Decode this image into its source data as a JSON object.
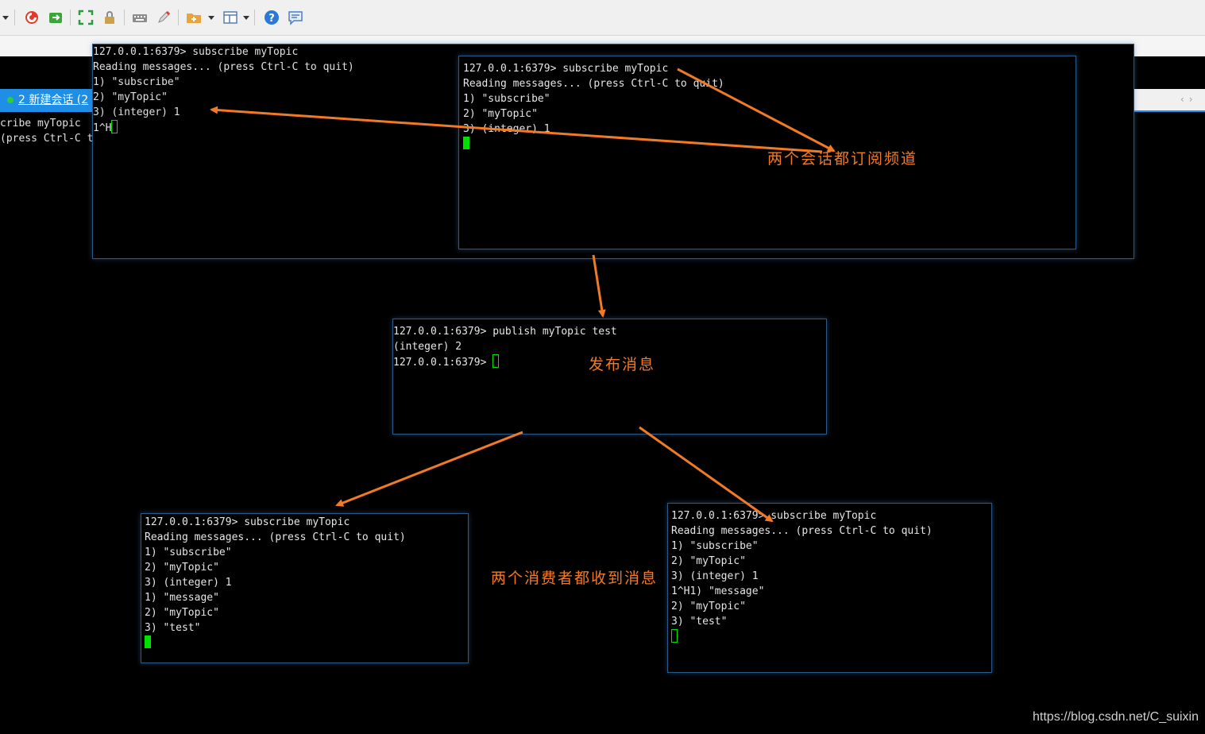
{
  "tab": {
    "label": "2 新建会话 (2"
  },
  "edge_lines": [
    "cribe myTopic",
    "(press Ctrl-C t"
  ],
  "terminals": {
    "session1": [
      "127.0.0.1:6379> subscribe myTopic",
      "Reading messages... (press Ctrl-C to quit)",
      "1) \"subscribe\"",
      "2) \"myTopic\"",
      "3) (integer) 1",
      "1^H"
    ],
    "session2": [
      "127.0.0.1:6379> subscribe myTopic",
      "Reading messages... (press Ctrl-C to quit)",
      "1) \"subscribe\"",
      "2) \"myTopic\"",
      "3) (integer) 1"
    ],
    "publisher": [
      "127.0.0.1:6379> publish myTopic test",
      "(integer) 2",
      "127.0.0.1:6379> "
    ],
    "consumer1": [
      "127.0.0.1:6379> subscribe myTopic",
      "Reading messages... (press Ctrl-C to quit)",
      "1) \"subscribe\"",
      "2) \"myTopic\"",
      "3) (integer) 1",
      "1) \"message\"",
      "2) \"myTopic\"",
      "3) \"test\""
    ],
    "consumer2": [
      "127.0.0.1:6379> subscribe myTopic",
      "Reading messages... (press Ctrl-C to quit)",
      "1) \"subscribe\"",
      "2) \"myTopic\"",
      "3) (integer) 1",
      "1^H1) \"message\"",
      "2) \"myTopic\"",
      "3) \"test\""
    ]
  },
  "annotations": {
    "subscribe_note": "两个会话都订阅频道",
    "publish_note": "发布消息",
    "receive_note": "两个消费者都收到消息"
  },
  "watermark": "https://blog.csdn.net/C_suixin",
  "colors": {
    "annotation": "#f07a25",
    "cursor": "#00e000",
    "tab_active": "#1e8ee6"
  }
}
